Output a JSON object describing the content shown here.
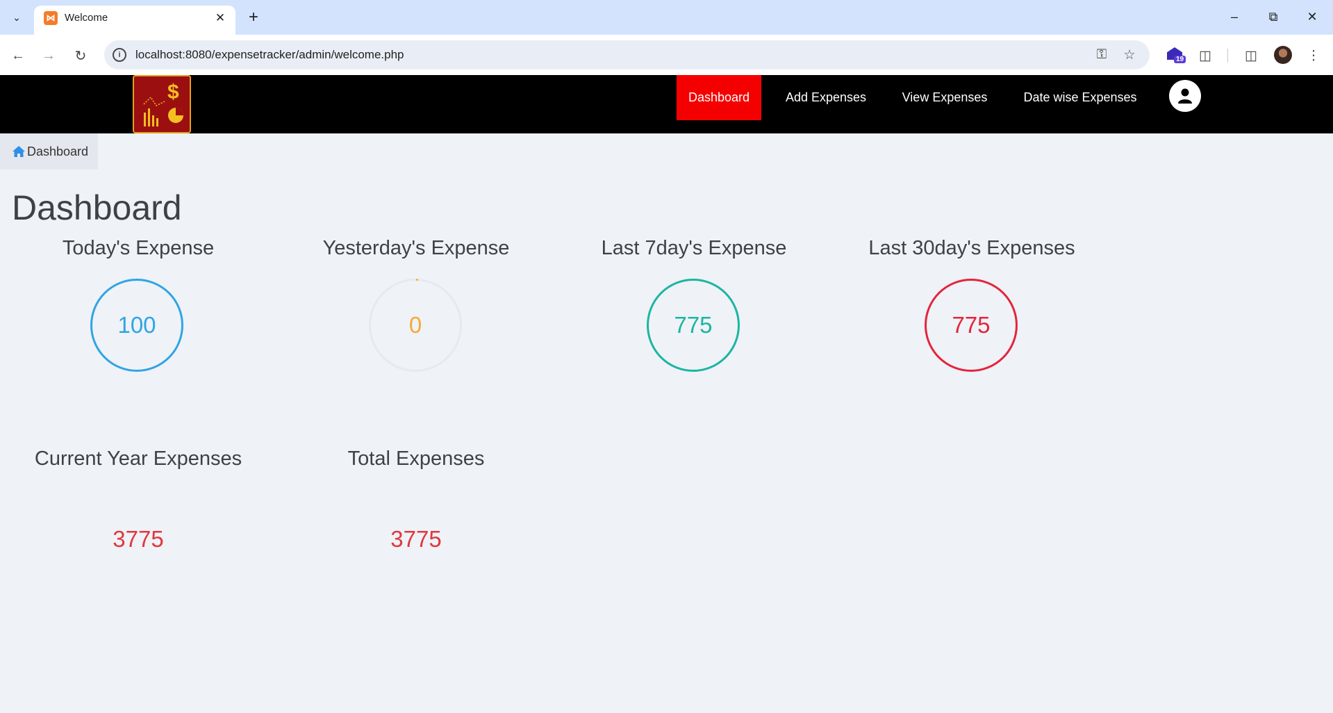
{
  "browser": {
    "tab_title": "Welcome",
    "url": "localhost:8080/expensetracker/admin/welcome.php",
    "extension_badge": "19"
  },
  "header": {
    "nav": [
      "Dashboard",
      "Add Expenses",
      "View Expenses",
      "Date wise Expenses"
    ],
    "active_nav": "Dashboard",
    "colors": {
      "bar": "#000000",
      "active": "#f40000"
    }
  },
  "breadcrumb": {
    "label": "Dashboard"
  },
  "page": {
    "title": "Dashboard"
  },
  "cards": {
    "today": {
      "title": "Today's Expense",
      "value": "100",
      "color": "#2fa4e7"
    },
    "yesterday": {
      "title": "Yesterday's Expense",
      "value": "0",
      "color": "#f6a935"
    },
    "last7": {
      "title": "Last 7day's Expense",
      "value": "775",
      "color": "#1bb5a3"
    },
    "last30": {
      "title": "Last 30day's Expenses",
      "value": "775",
      "color": "#e4243d"
    },
    "year": {
      "title": "Current Year Expenses",
      "value": "3775",
      "color": "#e0373e"
    },
    "total": {
      "title": "Total Expenses",
      "value": "3775",
      "color": "#e0373e"
    }
  }
}
